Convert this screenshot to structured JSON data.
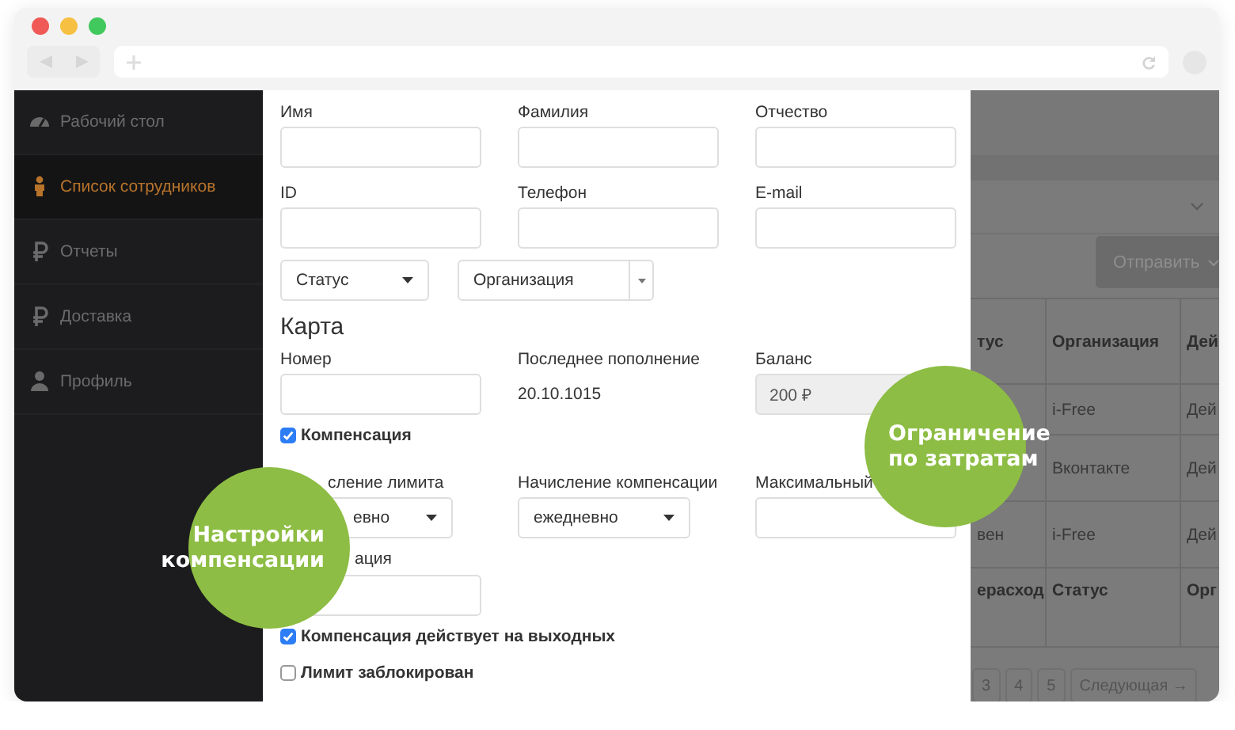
{
  "sidebar": {
    "items": [
      {
        "label": "Рабочий стол",
        "selected": false
      },
      {
        "label": "Список сотрудников",
        "selected": true
      },
      {
        "label": "Отчеты",
        "selected": false
      },
      {
        "label": "Доставка",
        "selected": false
      },
      {
        "label": "Профиль",
        "selected": false
      }
    ]
  },
  "form": {
    "name_fields": [
      {
        "label": "Имя"
      },
      {
        "label": "Фамилия"
      },
      {
        "label": "Отчество"
      }
    ],
    "contact_fields": [
      {
        "label": "ID"
      },
      {
        "label": "Телефон"
      },
      {
        "label": "E-mail"
      }
    ],
    "status_select": {
      "value": "Статус"
    },
    "organization_select": {
      "value": "Организация"
    },
    "card": {
      "heading": "Карта",
      "number_label": "Номер",
      "last_topup_label": "Последнее пополнение",
      "last_topup_value": "20.10.1015",
      "balance_label": "Баланс",
      "balance_value": "200 ₽"
    },
    "compensation_checkbox": {
      "label": "Компенсация",
      "checked": true
    },
    "limit_accrual": {
      "label": "сление лимита",
      "value": "евно"
    },
    "compensation_accrual": {
      "label": "Начисление компенсации",
      "value": "ежедневно"
    },
    "max_limit": {
      "label": "Максимальный"
    },
    "field_4": {
      "label": "ация"
    },
    "checkboxes": [
      {
        "label": "Компенсация действует на выходных",
        "checked": true
      },
      {
        "label": "Лимит заблокирован",
        "checked": false
      }
    ]
  },
  "background_page": {
    "send_button": "Отправить",
    "table": {
      "header": {
        "column_1": "тус",
        "organization": "Организация",
        "column_3": "Дей"
      },
      "rows": [
        {
          "organization": "i-Free",
          "column_3": "Дей"
        },
        {
          "organization": "Вконтакте",
          "column_3": "Дей"
        },
        {
          "column_1": "вен",
          "organization": "i-Free",
          "column_3": "Дей"
        }
      ],
      "footer": {
        "column_1": "ерасход",
        "organization": "Статус",
        "column_3": "Орг"
      }
    },
    "pagination": [
      {
        "label": "3"
      },
      {
        "label": "4"
      },
      {
        "label": "5"
      },
      {
        "label": "Следующая →"
      }
    ]
  },
  "callouts": [
    {
      "text": "Настройки компенсации"
    },
    {
      "text": "Ограничение по затратам"
    }
  ]
}
